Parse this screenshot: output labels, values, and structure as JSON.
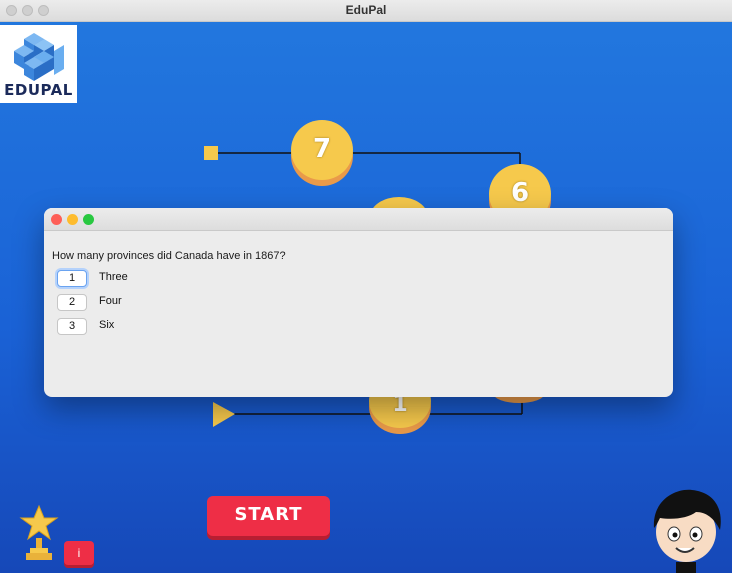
{
  "window": {
    "title": "EduPal"
  },
  "logo": {
    "text": "EDUPAL"
  },
  "board": {
    "coins": [
      {
        "label": "7"
      },
      {
        "label": "6"
      },
      {
        "label": "1"
      }
    ]
  },
  "buttons": {
    "start_label": "START",
    "info_label": "i"
  },
  "dialog": {
    "question": "How many provinces did Canada have in 1867?",
    "options": [
      {
        "key": "1",
        "label": "Three"
      },
      {
        "key": "2",
        "label": "Four"
      },
      {
        "key": "3",
        "label": "Six"
      }
    ]
  },
  "colors": {
    "background": "#1a62d6",
    "coin": "#f6c94c",
    "start_button": "#ee2e46",
    "logo_blue": "#4a9ae8"
  }
}
